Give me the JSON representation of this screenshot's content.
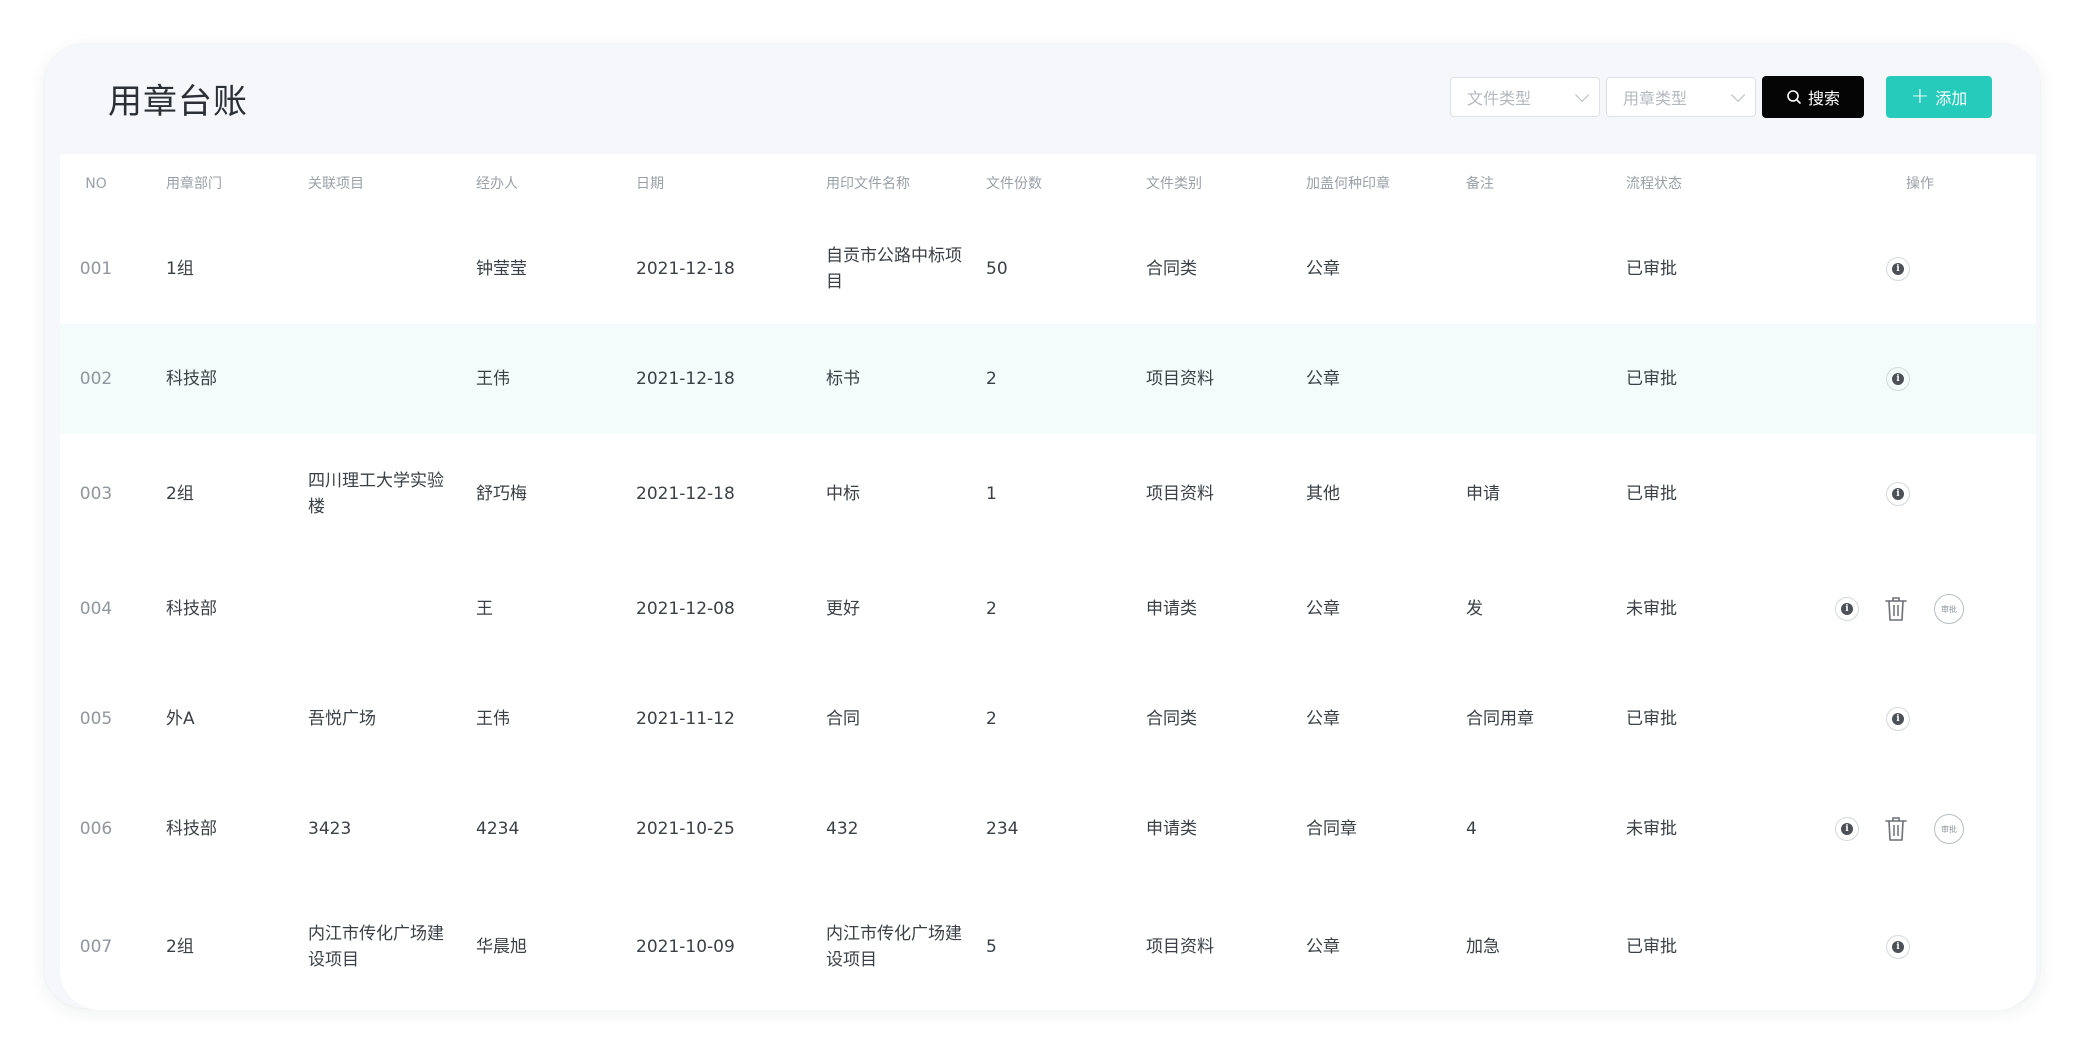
{
  "header": {
    "title": "用章台账",
    "filter_file_type_placeholder": "文件类型",
    "filter_seal_type_placeholder": "用章类型",
    "search_label": "搜索",
    "add_label": "添加"
  },
  "table": {
    "columns": [
      "NO",
      "用章部门",
      "关联项目",
      "经办人",
      "日期",
      "用印文件名称",
      "文件份数",
      "文件类别",
      "加盖何种印章",
      "备注",
      "流程状态",
      "操作"
    ],
    "rows": [
      {
        "no": "001",
        "dept": "1组",
        "project": "",
        "handler": "钟莹莹",
        "date": "2021-12-18",
        "doc_name": "自贡市公路中标项目",
        "copies": "50",
        "category": "合同类",
        "seal": "公章",
        "remark": "",
        "status": "已审批"
      },
      {
        "no": "002",
        "dept": "科技部",
        "project": "",
        "handler": "王伟",
        "date": "2021-12-18",
        "doc_name": "标书",
        "copies": "2",
        "category": "项目资料",
        "seal": "公章",
        "remark": "",
        "status": "已审批"
      },
      {
        "no": "003",
        "dept": "2组",
        "project": "四川理工大学实验楼",
        "handler": "舒巧梅",
        "date": "2021-12-18",
        "doc_name": "中标",
        "copies": "1",
        "category": "项目资料",
        "seal": "其他",
        "remark": "申请",
        "status": "已审批"
      },
      {
        "no": "004",
        "dept": "科技部",
        "project": "",
        "handler": "王",
        "date": "2021-12-08",
        "doc_name": "更好",
        "copies": "2",
        "category": "申请类",
        "seal": "公章",
        "remark": "发",
        "status": "未审批",
        "approve_label": "审批"
      },
      {
        "no": "005",
        "dept": "外A",
        "project": "吾悦广场",
        "handler": "王伟",
        "date": "2021-11-12",
        "doc_name": "合同",
        "copies": "2",
        "category": "合同类",
        "seal": "公章",
        "remark": "合同用章",
        "status": "已审批"
      },
      {
        "no": "006",
        "dept": "科技部",
        "project": "3423",
        "handler": "4234",
        "date": "2021-10-25",
        "doc_name": "432",
        "copies": "234",
        "category": "申请类",
        "seal": "合同章",
        "remark": "4",
        "status": "未审批",
        "approve_label": "审批"
      },
      {
        "no": "007",
        "dept": "2组",
        "project": "内江市传化广场建设项目",
        "handler": "华晨旭",
        "date": "2021-10-09",
        "doc_name": "内江市传化广场建设项目",
        "copies": "5",
        "category": "项目资料",
        "seal": "公章",
        "remark": "加急",
        "status": "已审批"
      }
    ]
  },
  "icons": {
    "search": "search-icon",
    "add": "plus-icon",
    "detail": "info-icon",
    "delete": "trash-icon",
    "approve": "approve-stamp-icon"
  },
  "colors": {
    "accent": "#26cbbb",
    "search_button": "#050505",
    "row_highlight": "#f3fcfb",
    "card_background": "#f5f7fa"
  }
}
